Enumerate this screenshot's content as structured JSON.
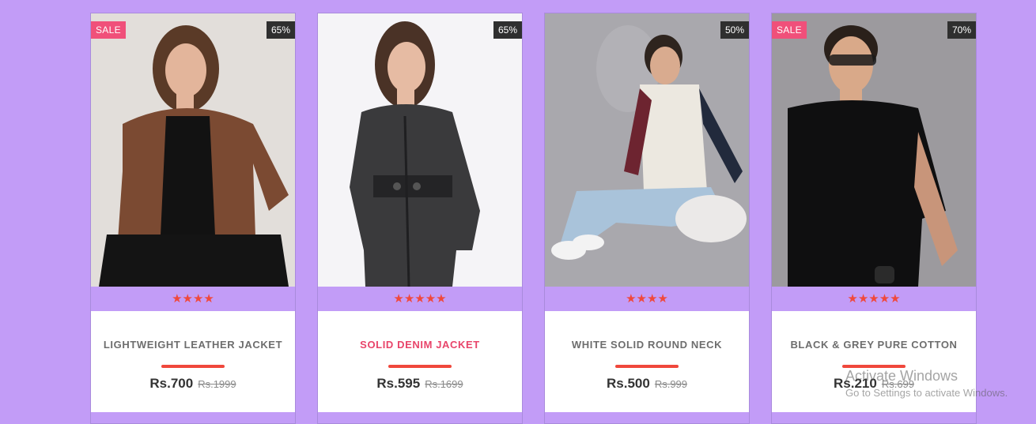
{
  "products": [
    {
      "name": "LIGHTWEIGHT LEATHER JACKET",
      "price": "Rs.700",
      "old_price": "Rs.1999",
      "discount": "65%",
      "sale": "SALE",
      "stars": "★★★★",
      "highlight": false
    },
    {
      "name": "SOLID DENIM JACKET",
      "price": "Rs.595",
      "old_price": "Rs.1699",
      "discount": "65%",
      "sale": "",
      "stars": "★★★★★",
      "highlight": true
    },
    {
      "name": "WHITE SOLID ROUND NECK",
      "price": "Rs.500",
      "old_price": "Rs.999",
      "discount": "50%",
      "sale": "",
      "stars": "★★★★",
      "highlight": false
    },
    {
      "name": "BLACK & GREY PURE COTTON",
      "price": "Rs.210",
      "old_price": "Rs.699",
      "discount": "70%",
      "sale": "SALE",
      "stars": "★★★★★",
      "highlight": false
    }
  ],
  "watermark": {
    "title": "Activate Windows",
    "subtitle": "Go to Settings to activate Windows."
  },
  "colors": {
    "background": "#c29cf7",
    "sale_badge": "#f0507a",
    "discount_badge": "#2f2f2f",
    "star": "#f0483c",
    "price_bar": "#f0483c",
    "highlight_name": "#e8446a"
  }
}
